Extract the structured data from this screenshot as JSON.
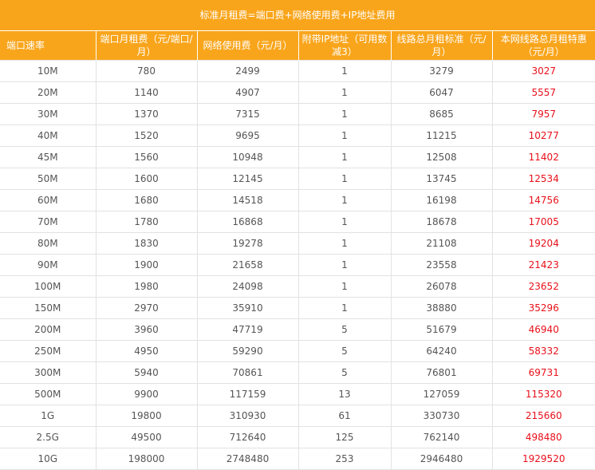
{
  "title": "标准月租费=端口费+网络使用费+IP地址费用",
  "headers": {
    "speed": "端口速率",
    "port_fee": "端口月租费（元/端口/月）",
    "network_fee": "网络使用费（元/月）",
    "ip": "附带IP地址（可用数减3）",
    "standard": "线路总月租标准（元/月）",
    "special": "本网线路总月租特惠（元/月）"
  },
  "rows": [
    [
      "10M",
      "780",
      "2499",
      "1",
      "3279",
      "3027"
    ],
    [
      "20M",
      "1140",
      "4907",
      "1",
      "6047",
      "5557"
    ],
    [
      "30M",
      "1370",
      "7315",
      "1",
      "8685",
      "7957"
    ],
    [
      "40M",
      "1520",
      "9695",
      "1",
      "11215",
      "10277"
    ],
    [
      "45M",
      "1560",
      "10948",
      "1",
      "12508",
      "11402"
    ],
    [
      "50M",
      "1600",
      "12145",
      "1",
      "13745",
      "12534"
    ],
    [
      "60M",
      "1680",
      "14518",
      "1",
      "16198",
      "14756"
    ],
    [
      "70M",
      "1780",
      "16868",
      "1",
      "18678",
      "17005"
    ],
    [
      "80M",
      "1830",
      "19278",
      "1",
      "21108",
      "19204"
    ],
    [
      "90M",
      "1900",
      "21658",
      "1",
      "23558",
      "21423"
    ],
    [
      "100M",
      "1980",
      "24098",
      "1",
      "26078",
      "23652"
    ],
    [
      "150M",
      "2970",
      "35910",
      "1",
      "38880",
      "35296"
    ],
    [
      "200M",
      "3960",
      "47719",
      "5",
      "51679",
      "46940"
    ],
    [
      "250M",
      "4950",
      "59290",
      "5",
      "64240",
      "58332"
    ],
    [
      "300M",
      "5940",
      "70861",
      "5",
      "76801",
      "69731"
    ],
    [
      "500M",
      "9900",
      "117159",
      "13",
      "127059",
      "115320"
    ],
    [
      "1G",
      "19800",
      "310930",
      "61",
      "330730",
      "215660"
    ],
    [
      "2.5G",
      "49500",
      "712640",
      "125",
      "762140",
      "498480"
    ],
    [
      "10G",
      "198000",
      "2748480",
      "253",
      "2946480",
      "1929520"
    ]
  ],
  "colors": {
    "header_bg": "#f9a51b",
    "header_text": "#ffffff",
    "special_text": "#e8101a",
    "body_text": "#555555"
  }
}
